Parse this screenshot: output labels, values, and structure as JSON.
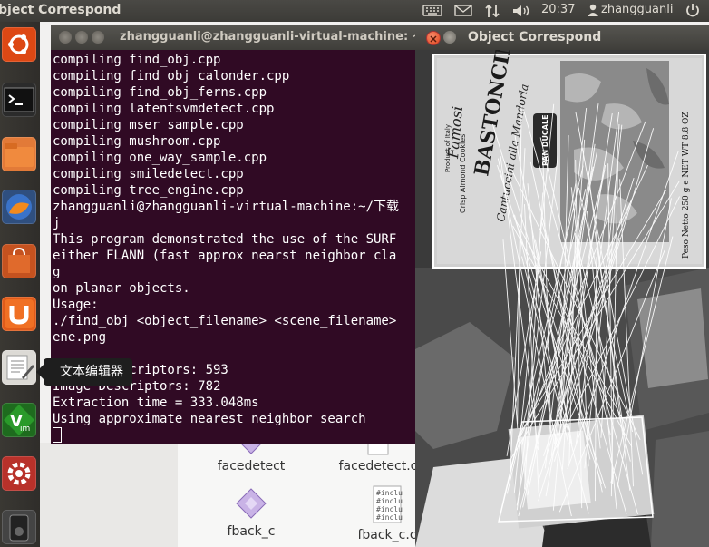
{
  "top_panel": {
    "active_window_title": "bject Correspond",
    "clock": "20:37",
    "user": "zhangguanli",
    "icons": [
      "keyboard-icon",
      "mail-icon",
      "network-icon",
      "volume-icon",
      "user-icon"
    ]
  },
  "launcher": {
    "items": [
      "ubuntu-dash-icon",
      "terminal-app-icon",
      "files-app-icon",
      "firefox-app-icon",
      "software-center-icon",
      "ubuntu-one-icon",
      "text-editor-app-icon",
      "vim-app-icon",
      "system-settings-icon",
      "device-icon"
    ],
    "tooltip": "文本编辑器"
  },
  "terminal": {
    "title": "zhangguanli@zhangguanli-virtual-machine: ~/",
    "lines": [
      "compiling find_obj.cpp",
      "compiling find_obj_calonder.cpp",
      "compiling find_obj_ferns.cpp",
      "compiling latentsvmdetect.cpp",
      "compiling mser_sample.cpp",
      "compiling mushroom.cpp",
      "compiling one_way_sample.cpp",
      "compiling smiledetect.cpp",
      "compiling tree_engine.cpp",
      "zhangguanli@zhangguanli-virtual-machine:~/下载",
      "j",
      "This program demonstrated the use of the SURF",
      "either FLANN (fast approx nearst neighbor cla",
      "g",
      "on planar objects.",
      "Usage:",
      "./find_obj <object_filename> <scene_filename>",
      "ene.png",
      "",
      "Object Descriptors: 593",
      "Image Descriptors: 782",
      "Extraction time = 333.048ms",
      "Using approximate nearest neighbor search"
    ]
  },
  "file_manager": {
    "files": [
      {
        "name": "facedetect",
        "icon": "executable-icon"
      },
      {
        "name": "facedetect.c",
        "icon": "source-file-icon"
      },
      {
        "name": "fback_c",
        "icon": "executable-icon"
      },
      {
        "name": "fback_c.c",
        "icon": "source-file-icon"
      }
    ]
  },
  "image_window": {
    "title": "Object Correspond",
    "box_text": {
      "brand": "BASTONCINI",
      "product_of": "Product of Italy",
      "subtitle": "Crisp Almond Cookies",
      "famosi": "Famosi",
      "cantuccini": "Cantuccini alla Mandorla",
      "maker": "PAN DUCALE",
      "weight": "Peso Netto 250 g e NET WT 8.8 OZ"
    }
  }
}
